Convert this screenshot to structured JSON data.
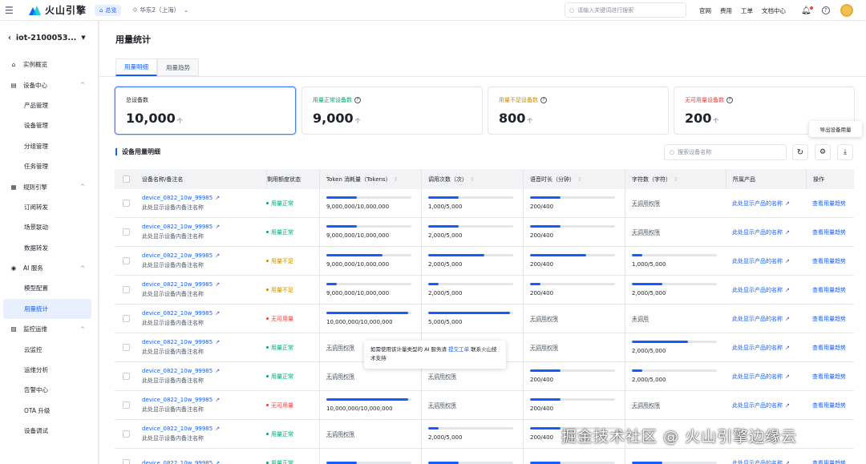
{
  "topbar": {
    "brand": "火山引擎",
    "home": "总览",
    "region": "华东2（上海）",
    "search_placeholder": "请输入关键词进行搜索",
    "links": [
      "官网",
      "费用",
      "工单",
      "文档中心"
    ]
  },
  "sidebar": {
    "project": "iot-2100053...",
    "items": [
      {
        "label": "实例概览",
        "type": "group",
        "icon": "home-icon"
      },
      {
        "label": "设备中心",
        "type": "group",
        "icon": "device-icon",
        "caret": "^"
      },
      {
        "label": "产品管理",
        "type": "sub"
      },
      {
        "label": "设备管理",
        "type": "sub"
      },
      {
        "label": "分组管理",
        "type": "sub"
      },
      {
        "label": "任务管理",
        "type": "sub"
      },
      {
        "label": "规则引擎",
        "type": "group",
        "icon": "rule-icon",
        "caret": "^"
      },
      {
        "label": "订阅转发",
        "type": "sub"
      },
      {
        "label": "场景联动",
        "type": "sub"
      },
      {
        "label": "数据转发",
        "type": "sub"
      },
      {
        "label": "AI 服务",
        "type": "group",
        "icon": "ai-icon",
        "caret": "^"
      },
      {
        "label": "模型配置",
        "type": "sub"
      },
      {
        "label": "用量统计",
        "type": "sub",
        "active": true
      },
      {
        "label": "监控运维",
        "type": "group",
        "icon": "monitor-icon",
        "caret": "^"
      },
      {
        "label": "云监控",
        "type": "sub"
      },
      {
        "label": "运维分析",
        "type": "sub"
      },
      {
        "label": "告警中心",
        "type": "sub"
      },
      {
        "label": "OTA 升级",
        "type": "sub"
      },
      {
        "label": "设备调试",
        "type": "sub"
      }
    ]
  },
  "page": {
    "title": "用量统计",
    "tabs": [
      "用量明细",
      "用量趋势"
    ],
    "active_tab": 0
  },
  "stats": [
    {
      "label": "总设备数",
      "value": "10,000",
      "unit": "个",
      "color": "#1d2129"
    },
    {
      "label": "用量正常设备数",
      "value": "9,000",
      "unit": "个",
      "color": "#00a870"
    },
    {
      "label": "用量不足设备数",
      "value": "800",
      "unit": "个",
      "color": "#c98f00"
    },
    {
      "label": "无可用量设备数",
      "value": "200",
      "unit": "个",
      "color": "#f53f3f"
    }
  ],
  "export_tooltip": "导出设备用量",
  "section": {
    "title": "设备用量明细",
    "search_placeholder": "搜索设备名称"
  },
  "table": {
    "headers": [
      "设备名称/备注名",
      "剩用额度状态",
      "Token 消耗量（Tokens）",
      "调用次数（次）",
      "语音时长（分钟）",
      "字符数（字符）",
      "所属产品",
      "操作"
    ],
    "rows": [
      {
        "name": "device_0822_10w_99985",
        "note": "此处显示设备内备注名称",
        "status": "用量正常",
        "status_color": "#00a870",
        "token": {
          "pct": 0.36,
          "text": "9,000,000/10,000,000"
        },
        "calls": {
          "pct": 0.36,
          "text": "1,000/5,000"
        },
        "voice": {
          "pct": 0.36,
          "text": "200/400"
        },
        "chars": {
          "na": "无调用权限"
        },
        "product": "此处显示产品的名称",
        "action": "查看用量趋势"
      },
      {
        "name": "device_0822_10w_99985",
        "note": "此处显示设备内备注名称",
        "status": "用量正常",
        "status_color": "#00a870",
        "token": {
          "pct": 0.36,
          "text": "9,000,000/10,000,000"
        },
        "calls": {
          "pct": 0.36,
          "text": "2,000/5,000"
        },
        "voice": {
          "pct": 0.36,
          "text": "200/400"
        },
        "chars": {
          "na": "无调用权限"
        },
        "product": "此处显示产品的名称",
        "action": "查看用量趋势"
      },
      {
        "name": "device_0822_10w_99985",
        "note": "此处显示设备内备注名称",
        "status": "用量不足",
        "status_color": "#c98f00",
        "token": {
          "pct": 0.66,
          "text": "9,000,000/10,000,000"
        },
        "calls": {
          "pct": 0.66,
          "text": "2,000/5,000"
        },
        "voice": {
          "pct": 0.66,
          "text": "200/400"
        },
        "chars": {
          "pct": 0.12,
          "text": "1,000/5,000"
        },
        "product": "此处显示产品的名称",
        "action": "查看用量趋势"
      },
      {
        "name": "device_0822_10w_99985",
        "note": "此处显示设备内备注名称",
        "status": "用量不足",
        "status_color": "#c98f00",
        "token": {
          "pct": 0.12,
          "text": "9,000,000/10,000,000"
        },
        "calls": {
          "pct": 0.12,
          "text": "2,000/5,000"
        },
        "voice": {
          "pct": 0.12,
          "text": "200/400"
        },
        "chars": {
          "pct": 0.36,
          "text": "2,000/5,000"
        },
        "product": "此处显示产品的名称",
        "action": "查看用量趋势"
      },
      {
        "name": "device_0822_10w_99985",
        "note": "此处显示设备内备注名称",
        "status": "无可用量",
        "status_color": "#f53f3f",
        "token": {
          "pct": 0.96,
          "text": "10,000,000/10,000,000"
        },
        "calls": {
          "pct": 0.96,
          "text": "5,000/5,000"
        },
        "voice": {
          "na": "无调用权限"
        },
        "chars": {
          "na": "未调用"
        },
        "product": "此处显示产品的名称",
        "action": "查看用量趋势"
      },
      {
        "name": "device_0822_10w_99985",
        "note": "此处显示设备内备注名称",
        "status": "用量正常",
        "status_color": "#00a870",
        "token": {
          "na": "无调用权限"
        },
        "calls": {
          "na": ""
        },
        "voice": {
          "na": "无调用权限"
        },
        "chars": {
          "pct": 0.66,
          "text": "2,000/5,000"
        },
        "product": "此处显示产品的名称",
        "action": "查看用量趋势"
      },
      {
        "name": "device_0822_10w_99985",
        "note": "此处显示设备内备注名称",
        "status": "用量正常",
        "status_color": "#00a870",
        "token": {
          "na": "无调用权限"
        },
        "calls": {
          "na": "无调用权限"
        },
        "voice": {
          "pct": 0.36,
          "text": "200/400"
        },
        "chars": {
          "pct": 0.12,
          "text": "2,000/5,000"
        },
        "product": "此处显示产品的名称",
        "action": "查看用量趋势"
      },
      {
        "name": "device_0822_10w_99985",
        "note": "此处显示设备内备注名称",
        "status": "无可用量",
        "status_color": "#f53f3f",
        "token": {
          "pct": 0.96,
          "text": "10,000,000/10,000,000"
        },
        "calls": {
          "na": "无调用权限"
        },
        "voice": {
          "pct": 0.36,
          "text": "200/400"
        },
        "chars": {
          "na": "无调用权限"
        },
        "product": "此处显示产品的名称",
        "action": "查看用量趋势"
      },
      {
        "name": "device_0822_10w_99985",
        "note": "此处显示设备内备注名称",
        "status": "用量正常",
        "status_color": "#00a870",
        "token": {
          "na": "无调用权限"
        },
        "calls": {
          "pct": 0.12,
          "text": "2,000/5,000"
        },
        "voice": {
          "pct": 0.36,
          "text": "200/400"
        },
        "chars": {
          "na": ""
        },
        "product": "",
        "action": ""
      },
      {
        "name": "device_0822_10w_99985",
        "note": "",
        "status": "用量正常",
        "status_color": "#00a870",
        "token": {
          "pct": 0.36,
          "text": ""
        },
        "calls": {
          "pct": 0.36,
          "text": ""
        },
        "voice": {
          "pct": 0.36,
          "text": ""
        },
        "chars": {
          "pct": 0.36,
          "text": ""
        },
        "product": "此处显示产品的名称",
        "action": "查看用量趋势"
      }
    ]
  },
  "ai_tooltip": {
    "text1": "如需使用该计量类型的 AI 服务请",
    "link": "提交工单",
    "text2": "联系火山技术支持"
  },
  "watermark": "掘金技术社区 @ 火山引擎边缘云"
}
